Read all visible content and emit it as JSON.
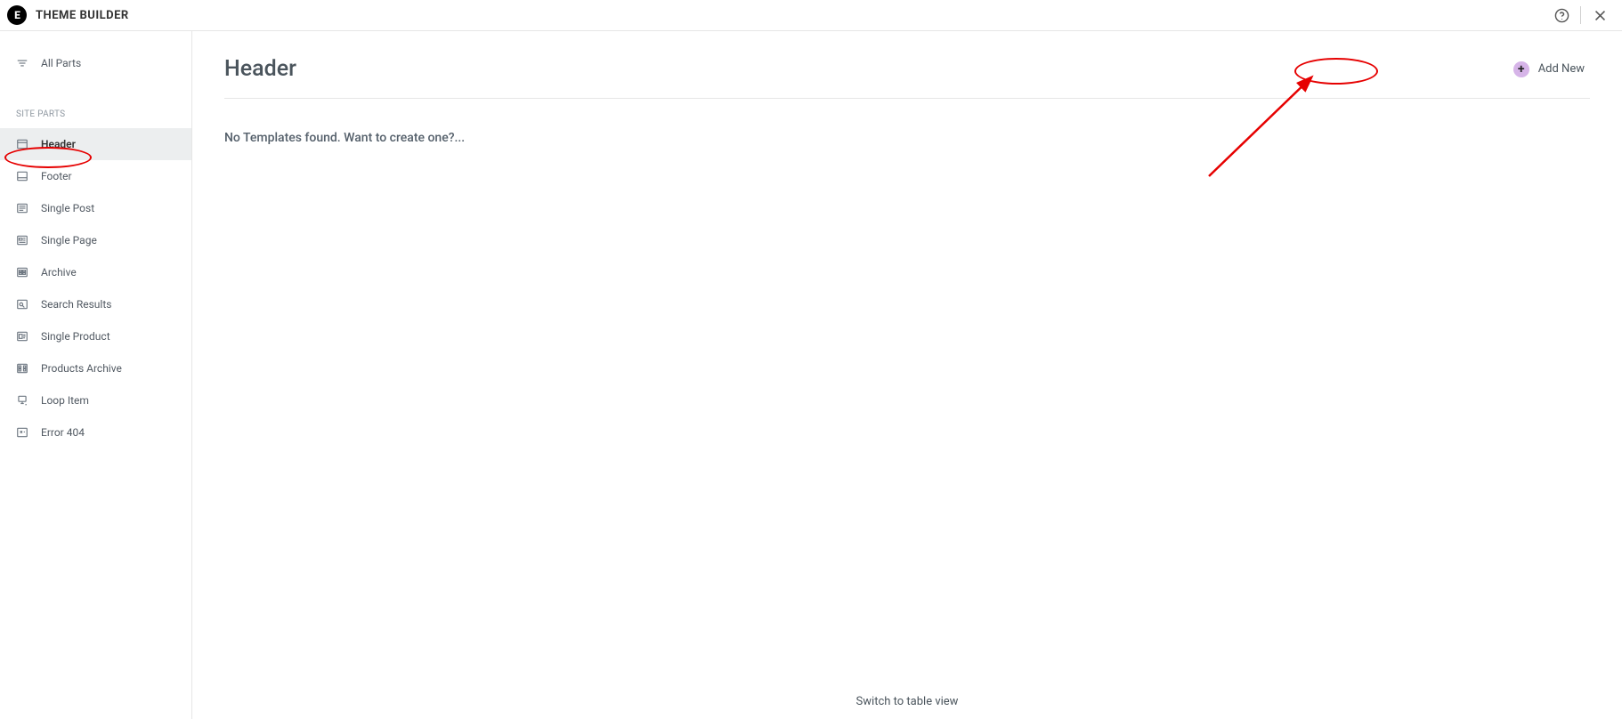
{
  "topbar": {
    "logo_text": "E",
    "title": "THEME BUILDER"
  },
  "sidebar": {
    "all_parts": "All Parts",
    "section_label": "SITE PARTS",
    "items": [
      {
        "label": "Header"
      },
      {
        "label": "Footer"
      },
      {
        "label": "Single Post"
      },
      {
        "label": "Single Page"
      },
      {
        "label": "Archive"
      },
      {
        "label": "Search Results"
      },
      {
        "label": "Single Product"
      },
      {
        "label": "Products Archive"
      },
      {
        "label": "Loop Item"
      },
      {
        "label": "Error 404"
      }
    ]
  },
  "main": {
    "title": "Header",
    "add_new": "Add New",
    "empty_text": "No Templates found. Want to create one?...",
    "bottom_link": "Switch to table view"
  }
}
